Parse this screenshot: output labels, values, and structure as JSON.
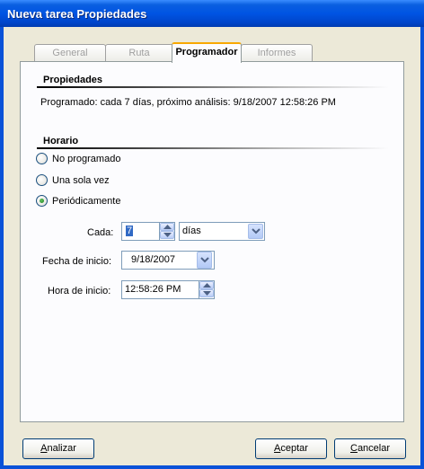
{
  "window": {
    "title": "Nueva tarea Propiedades"
  },
  "tabs": [
    {
      "label": "General",
      "active": false
    },
    {
      "label": "Ruta",
      "active": false
    },
    {
      "label": "Programador",
      "active": true
    },
    {
      "label": "Informes",
      "active": false
    }
  ],
  "propiedades": {
    "heading": "Propiedades",
    "summary": "Programado: cada 7 días, próximo análisis: 9/18/2007 12:58:26 PM"
  },
  "horario": {
    "heading": "Horario",
    "options": [
      {
        "label": "No programado",
        "checked": false
      },
      {
        "label": "Una sola vez",
        "checked": false
      },
      {
        "label": "Periódicamente",
        "checked": true
      }
    ]
  },
  "schedule": {
    "cada_label": "Cada:",
    "cada_value": "7",
    "unit_value": "días",
    "fecha_label": "Fecha de inicio:",
    "fecha_value": "9/18/2007",
    "hora_label": "Hora de inicio:",
    "hora_value": "12:58:26 PM"
  },
  "buttons": {
    "analizar_first": "A",
    "analizar_rest": "nalizar",
    "aceptar_first": "A",
    "aceptar_rest": "ceptar",
    "cancelar_first": "C",
    "cancelar_rest": "ancelar"
  },
  "icons": {
    "spin_up": "spin-up-arrow-icon",
    "spin_down": "spin-down-arrow-icon",
    "dropdown": "chevron-down-icon"
  },
  "colors": {
    "title_bar": "#0054e3",
    "selection": "#316ac5",
    "active_tab_accent": "#f8a800"
  }
}
